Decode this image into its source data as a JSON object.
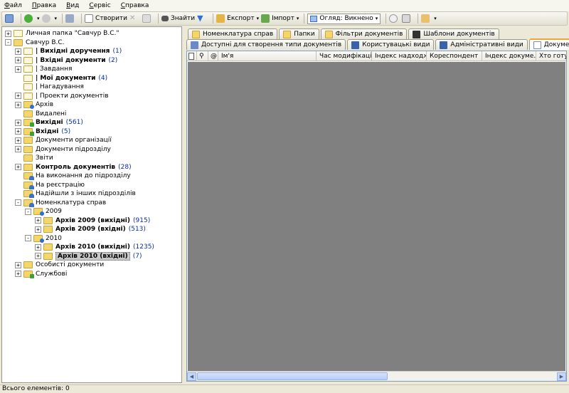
{
  "menu": [
    "Файл",
    "Правка",
    "Вид",
    "Сервіс",
    "Справка"
  ],
  "toolbar": {
    "create": "Створити",
    "find": "Знайти",
    "export": "Експорт",
    "import": "Імпорт",
    "view_combo": "Огляд: Викнено"
  },
  "tree": [
    {
      "label": "Личная папка \"Савчур В.С.\"",
      "count": "",
      "bold": false,
      "level": 0,
      "exp": "+",
      "icon": "folder-doc"
    },
    {
      "label": "Савчур В.С.",
      "count": "",
      "bold": false,
      "level": 0,
      "exp": "-",
      "icon": "folder"
    },
    {
      "label": "| Вихідні доручення",
      "count": "(1)",
      "bold": true,
      "level": 1,
      "exp": "+",
      "icon": "folder-doc"
    },
    {
      "label": "| Вхідні документи",
      "count": "(2)",
      "bold": true,
      "level": 1,
      "exp": "+",
      "icon": "folder-doc"
    },
    {
      "label": "| Завдання",
      "count": "",
      "bold": false,
      "level": 1,
      "exp": "+",
      "icon": "folder-doc"
    },
    {
      "label": "| Мої документи",
      "count": "(4)",
      "bold": true,
      "level": 1,
      "exp": "",
      "icon": "folder-doc"
    },
    {
      "label": "| Нагадування",
      "count": "",
      "bold": false,
      "level": 1,
      "exp": "",
      "icon": "folder-doc"
    },
    {
      "label": "| Проекти документів",
      "count": "",
      "bold": false,
      "level": 1,
      "exp": "+",
      "icon": "folder-doc"
    },
    {
      "label": "Архів",
      "count": "",
      "bold": false,
      "level": 1,
      "exp": "+",
      "icon": "folder-blue"
    },
    {
      "label": "Видалені",
      "count": "",
      "bold": false,
      "level": 1,
      "exp": "",
      "icon": "folder"
    },
    {
      "label": "Вихідні",
      "count": "(561)",
      "bold": true,
      "level": 1,
      "exp": "+",
      "icon": "folder-green"
    },
    {
      "label": "Вхідні",
      "count": "(5)",
      "bold": true,
      "level": 1,
      "exp": "+",
      "icon": "folder-green"
    },
    {
      "label": "Документи організації",
      "count": "",
      "bold": false,
      "level": 1,
      "exp": "+",
      "icon": "folder"
    },
    {
      "label": "Документи підрозділу",
      "count": "",
      "bold": false,
      "level": 1,
      "exp": "+",
      "icon": "folder"
    },
    {
      "label": "Звіти",
      "count": "",
      "bold": false,
      "level": 1,
      "exp": "",
      "icon": "folder"
    },
    {
      "label": "Контроль документів",
      "count": "(28)",
      "bold": true,
      "level": 1,
      "exp": "+",
      "icon": "folder"
    },
    {
      "label": "На виконання до підрозділу",
      "count": "",
      "bold": false,
      "level": 1,
      "exp": "",
      "icon": "folder-people"
    },
    {
      "label": "На реєстрацію",
      "count": "",
      "bold": false,
      "level": 1,
      "exp": "",
      "icon": "folder-people"
    },
    {
      "label": "Надійшли з інших підрозділів",
      "count": "",
      "bold": false,
      "level": 1,
      "exp": "",
      "icon": "folder-people"
    },
    {
      "label": "Номенклатура справ",
      "count": "",
      "bold": false,
      "level": 1,
      "exp": "-",
      "icon": "folder-people"
    },
    {
      "label": "2009",
      "count": "",
      "bold": false,
      "level": 2,
      "exp": "-",
      "icon": "folder-blue"
    },
    {
      "label": "Архів 2009 (вихідні)",
      "count": "(915)",
      "bold": true,
      "level": 3,
      "exp": "+",
      "icon": "folder"
    },
    {
      "label": "Архів 2009 (вхідні)",
      "count": "(513)",
      "bold": true,
      "level": 3,
      "exp": "+",
      "icon": "folder"
    },
    {
      "label": "2010",
      "count": "",
      "bold": false,
      "level": 2,
      "exp": "-",
      "icon": "folder-blue"
    },
    {
      "label": "Архів 2010 (вихідні)",
      "count": "(1235)",
      "bold": true,
      "level": 3,
      "exp": "+",
      "icon": "folder"
    },
    {
      "label": "Архів 2010 (вхідні)",
      "count": "(7)",
      "bold": true,
      "level": 3,
      "exp": "+",
      "icon": "folder",
      "selected": true
    },
    {
      "label": "Особисті документи",
      "count": "",
      "bold": false,
      "level": 1,
      "exp": "+",
      "icon": "folder"
    },
    {
      "label": "Службові",
      "count": "",
      "bold": false,
      "level": 1,
      "exp": "+",
      "icon": "folder-green"
    }
  ],
  "tabs_row1": [
    "Номенклатура справ",
    "Папки",
    "Фільтри документів",
    "Шаблони документів"
  ],
  "tabs_row2": [
    "Доступні для створення типи документів",
    "Користувацькі види",
    "Адміністративні види",
    "Документи"
  ],
  "grid_columns": [
    "Ім'я",
    "Час модифікації",
    "Індекс надходж...",
    "Кореспондент",
    "Індекс докуме...",
    "Хто готу"
  ],
  "status": "Всього елементів: 0"
}
